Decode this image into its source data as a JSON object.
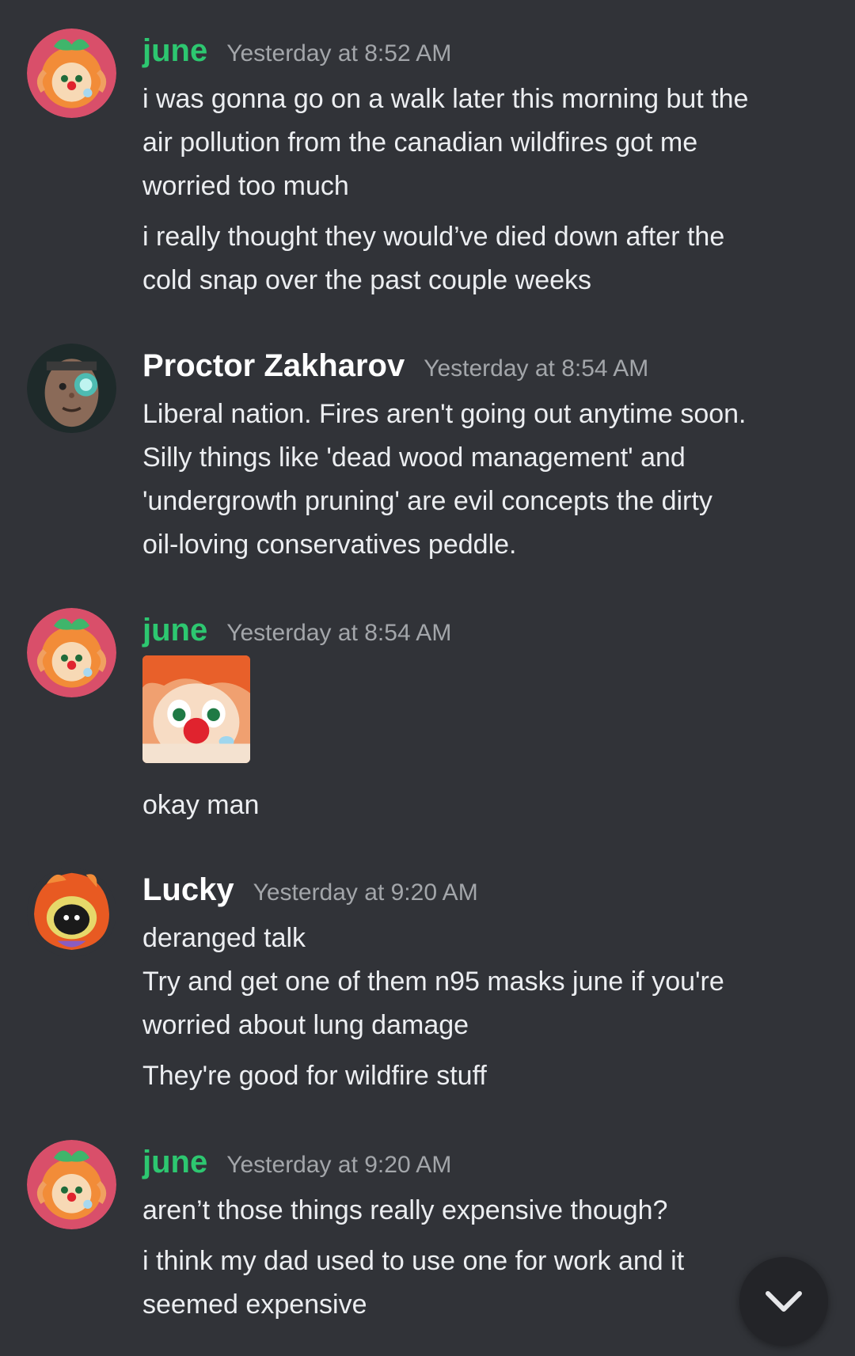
{
  "messages": [
    {
      "author": "june",
      "author_color": "#2dc770",
      "timestamp": "Yesterday at 8:52 AM",
      "avatar_icon": "clown-girl-avatar-icon",
      "lines": [
        "i was gonna go on a walk later this morning but the",
        "air pollution from the canadian wildfires got me",
        "worried too much",
        "i really thought they would’ve died down after the",
        "cold snap over the past couple weeks"
      ]
    },
    {
      "author": "Proctor Zakharov",
      "author_color": "#ffffff",
      "timestamp": "Yesterday at 8:54 AM",
      "avatar_icon": "cyborg-man-avatar-icon",
      "lines": [
        "Liberal nation. Fires aren't going out anytime soon.",
        "Silly things like 'dead wood management' and",
        "'undergrowth pruning' are evil concepts the dirty",
        "oil-loving conservatives peddle."
      ]
    },
    {
      "author": "june",
      "author_color": "#2dc770",
      "timestamp": "Yesterday at 8:54 AM",
      "avatar_icon": "clown-girl-avatar-icon",
      "sticker_icon": "clown-face-sticker-icon",
      "lines": [
        "okay man"
      ]
    },
    {
      "author": "Lucky",
      "author_color": "#ffffff",
      "timestamp": "Yesterday at 9:20 AM",
      "avatar_icon": "hooded-creature-avatar-icon",
      "lines": [
        "deranged talk",
        "Try and get one of them n95 masks june if you're",
        "worried about lung damage",
        "They're good for wildfire stuff"
      ]
    },
    {
      "author": "june",
      "author_color": "#2dc770",
      "timestamp": "Yesterday at 9:20 AM",
      "avatar_icon": "clown-girl-avatar-icon",
      "lines": [
        "aren’t those things really expensive though?",
        "i think my dad used to use one for work and it",
        "seemed expensive"
      ]
    }
  ],
  "jump_button": {
    "icon": "chevron-down-icon"
  }
}
